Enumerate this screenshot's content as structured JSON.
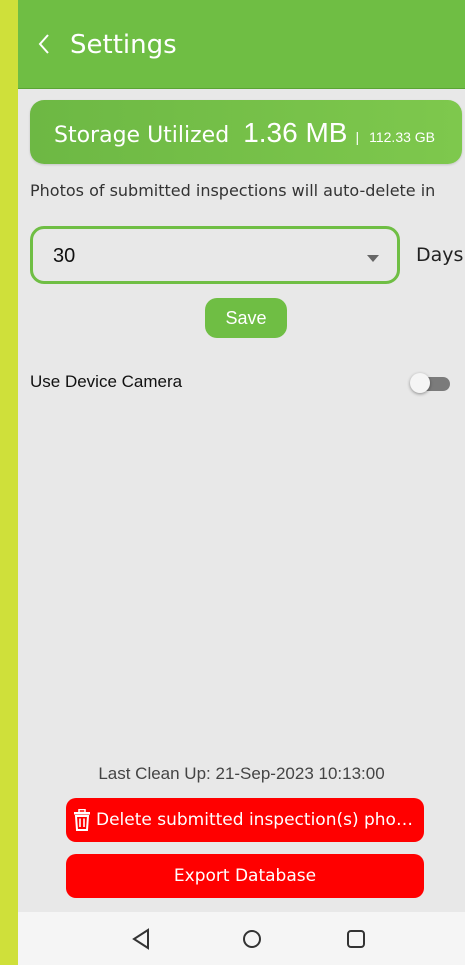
{
  "header": {
    "title": "Settings"
  },
  "storage": {
    "label": "Storage Utilized",
    "used": "1.36 MB",
    "separator": "|",
    "total": "112.33 GB"
  },
  "auto_delete": {
    "description": "Photos of submitted inspections will auto-delete in",
    "selected_value": "30",
    "unit": "Days",
    "save_label": "Save"
  },
  "camera": {
    "label": "Use Device Camera",
    "enabled": false
  },
  "cleanup": {
    "text": "Last Clean Up: 21-Sep-2023 10:13:00"
  },
  "actions": {
    "delete_label": "Delete submitted inspection(s) phot...",
    "export_label": "Export Database"
  },
  "colors": {
    "primary": "#6fbe44",
    "danger": "#ff0000",
    "background": "#e8e8e8"
  },
  "navbar": {
    "icons": [
      "back-triangle-icon",
      "home-circle-icon",
      "recents-square-icon"
    ]
  }
}
